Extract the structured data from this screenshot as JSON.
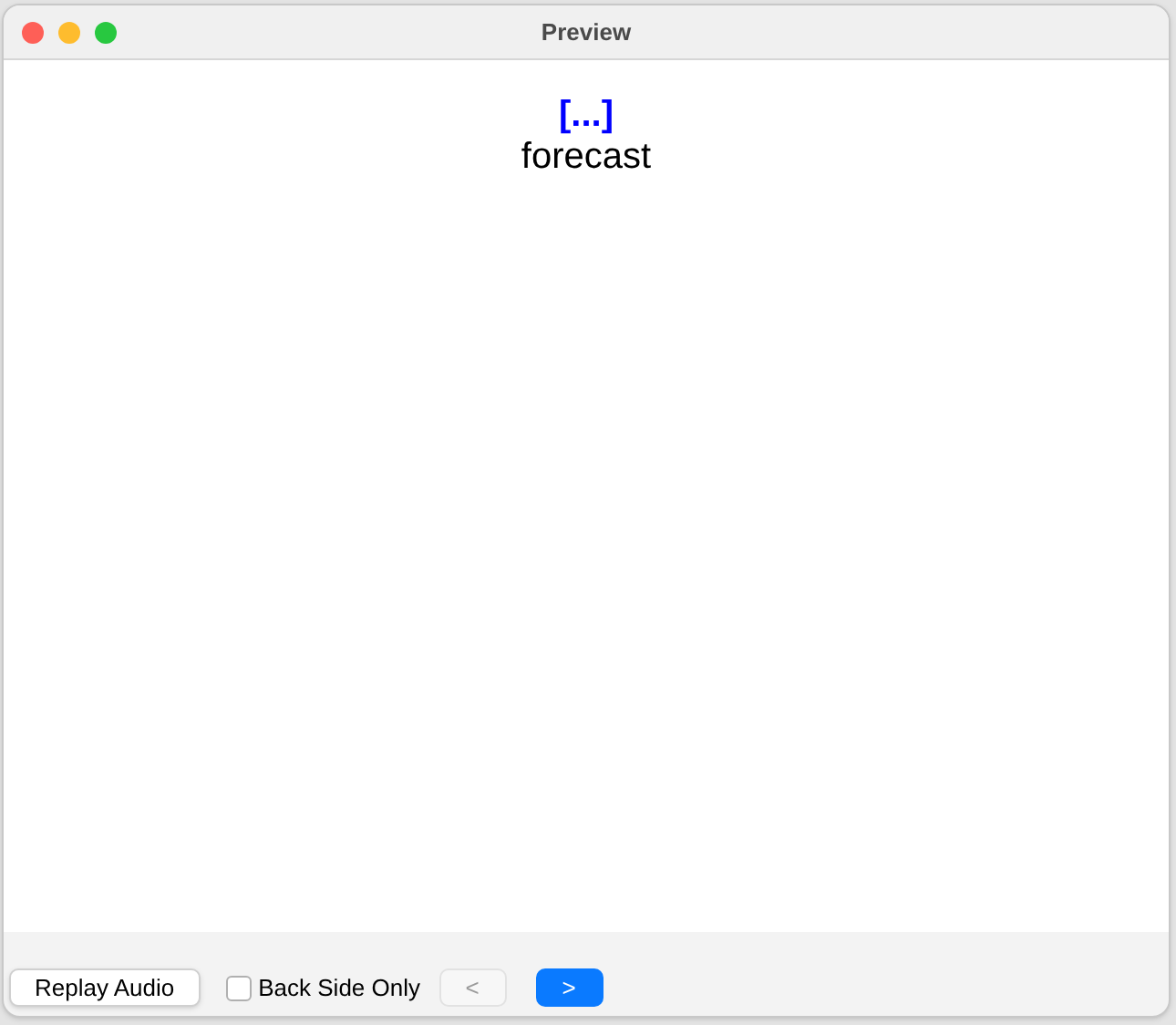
{
  "window": {
    "title": "Preview"
  },
  "card": {
    "cloze": "[...]",
    "text": "forecast"
  },
  "replay_button": {
    "label": "Replay Audio"
  },
  "back_side_only": {
    "label": "Back Side Only",
    "checked": false
  },
  "nav_buttons": [
    {
      "label": "<",
      "kind": "plain",
      "disabled": true
    },
    {
      "label": ">",
      "kind": "primary",
      "disabled": false
    }
  ]
}
